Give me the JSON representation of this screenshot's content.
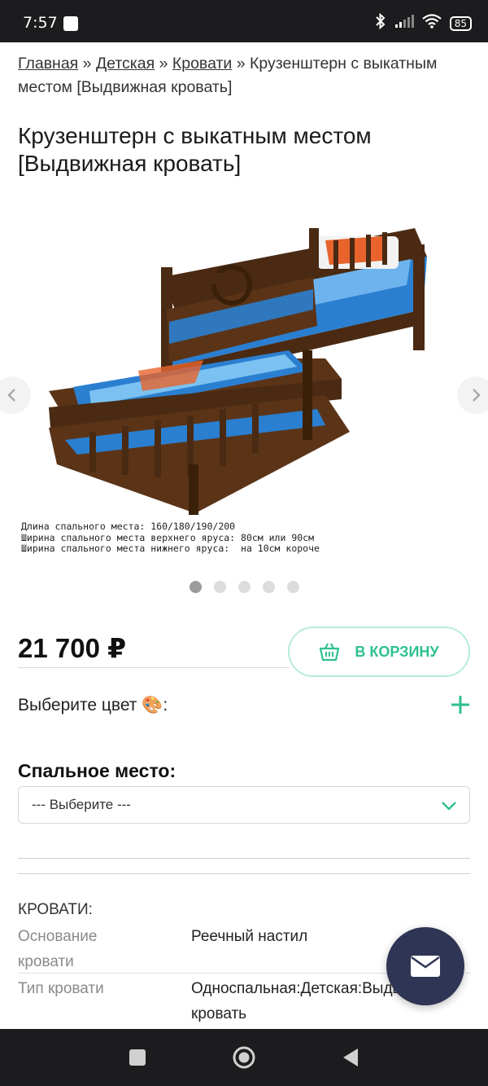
{
  "status_bar": {
    "time": "7:57",
    "battery": "85"
  },
  "breadcrumb": {
    "items": [
      "Главная",
      "Детская",
      "Кровати"
    ],
    "separator": "»",
    "current_line1": "Крузенштерн с выкатным",
    "current_line2": "местом [Выдвижная кровать]"
  },
  "title": {
    "line1": "Крузенштерн с выкатным местом",
    "line2": "[Выдвижная кровать]"
  },
  "gallery": {
    "caption_lines": [
      "Длина спального места: 160/180/190/200",
      "Ширина спального места верхнего яруса: 80см или 90см",
      "Ширина спального места нижнего яруса:  на 10см короче"
    ],
    "slides_count": 5,
    "active_index": 0
  },
  "product": {
    "price": "21 700 ₽",
    "cart_label": "В КОРЗИНУ",
    "color_label": "Выберите цвет 🎨:",
    "sleep_label": "Спальное место:",
    "select_value": "--- Выберите ---"
  },
  "specs": {
    "heading": "КРОВАТИ:",
    "rows": [
      {
        "key_line1": "Основание",
        "key_line2": "кровати",
        "val_line1": "Реечный настил",
        "val_line2": ""
      },
      {
        "key_line1": "Тип кровати",
        "key_line2": "",
        "val_line1": "Односпальная:Детская:Выдвижная",
        "val_line2": "кровать"
      }
    ]
  },
  "colors": {
    "accent": "#2fc08e",
    "fab": "#2f3554",
    "status_bar": "#1c1c1e"
  },
  "icons": {
    "cart": "basket-icon",
    "plus": "plus-icon",
    "select": "chevron-down-icon",
    "fab": "mail-icon"
  }
}
